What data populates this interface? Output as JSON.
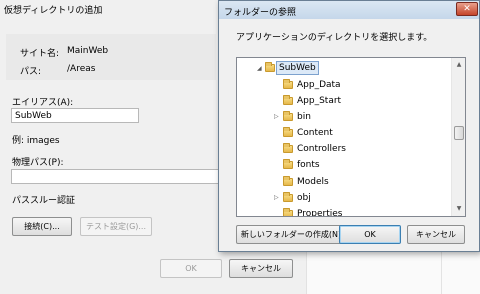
{
  "background_dialog": {
    "title": "仮想ディレクトリの追加",
    "site_label": "サイト名:",
    "site_value": "MainWeb",
    "path_label": "パス:",
    "path_value": "/Areas",
    "alias_label": "エイリアス(A):",
    "alias_value": "SubWeb",
    "example_text": "例: images",
    "physical_path_label": "物理パス(P):",
    "physical_path_value": "",
    "passthrough_label": "パススルー認証",
    "connect_button": "接続(C)...",
    "test_button": "テスト設定(G)...",
    "ok_button": "OK",
    "cancel_button": "キャンセル"
  },
  "browse_dialog": {
    "title": "フォルダーの参照",
    "close_icon": "close-icon",
    "prompt": "アプリケーションのディレクトリを選択します。",
    "tree": {
      "selected": "SubWeb",
      "root": {
        "label": "SubWeb",
        "expanded": true
      },
      "children": [
        {
          "label": "App_Data",
          "expandable": false
        },
        {
          "label": "App_Start",
          "expandable": false
        },
        {
          "label": "bin",
          "expandable": true
        },
        {
          "label": "Content",
          "expandable": false
        },
        {
          "label": "Controllers",
          "expandable": false
        },
        {
          "label": "fonts",
          "expandable": false
        },
        {
          "label": "Models",
          "expandable": false
        },
        {
          "label": "obj",
          "expandable": true
        },
        {
          "label": "Properties",
          "expandable": false
        }
      ]
    },
    "new_folder_button": "新しいフォルダーの作成(N)",
    "ok_button": "OK",
    "cancel_button": "キャンセル"
  },
  "colors": {
    "dialog_bg": "#f0f0f0",
    "title_bar": "#c5d7ea",
    "selection_bg": "#dce9f7",
    "selection_border": "#7da2ce",
    "close_button": "#c4442a",
    "folder": "#e5b84b"
  }
}
